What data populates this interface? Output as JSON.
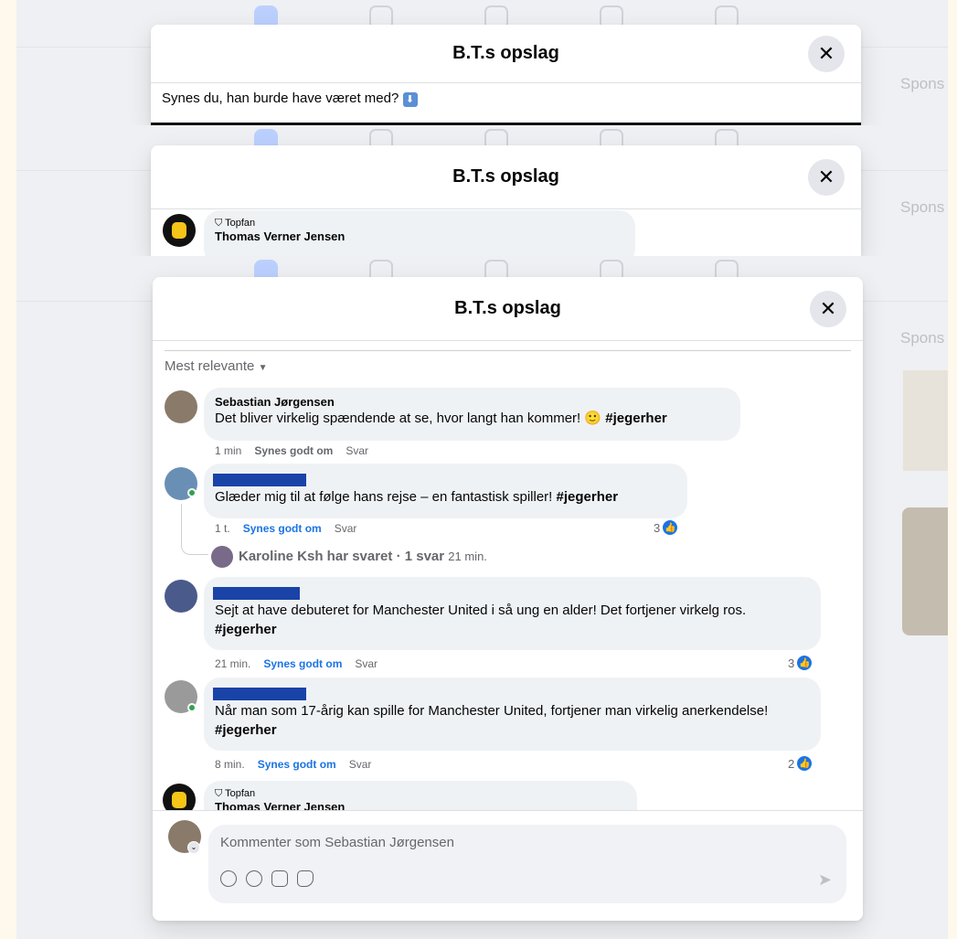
{
  "post_title": "B.T.s opslag",
  "close_glyph": "✕",
  "sponsored_label": "Spons",
  "panel1": {
    "caption": "Synes du, han burde have været med?",
    "caption_emoji": "⬇"
  },
  "panel2": {
    "badge": "Topfan",
    "name": "Thomas Verner Jensen"
  },
  "sort_label": "Mest relevante",
  "comments": [
    {
      "name": "Sebastian Jørgensen",
      "text": "Det bliver virkelig spændende at se, hvor langt han kommer!",
      "emoji": "🙂",
      "hashtag": "#jegerher",
      "time": "1 min",
      "like": "Synes godt om",
      "reply": "Svar",
      "count": ""
    },
    {
      "name": "",
      "text": "Glæder mig til at følge hans rejse – en fantastisk spiller!",
      "hashtag": "#jegerher",
      "time": "1 t.",
      "like": "Synes godt om",
      "reply": "Svar",
      "count": "3"
    },
    {
      "name": "",
      "text": "Sejt at have debuteret for Manchester United i så ung en alder! Det fortjener virkelg ros.",
      "hashtag": "#jegerher",
      "time": "21 min.",
      "like": "Synes godt om",
      "reply": "Svar",
      "count": "3"
    },
    {
      "name": "",
      "text": "Når man som 17-årig kan spille for Manchester United, fortjener man virkelig anerkendelse!",
      "hashtag": "#jegerher",
      "time": "8 min.",
      "like": "Synes godt om",
      "reply": "Svar",
      "count": "2"
    }
  ],
  "reply_thread": {
    "text": "Karoline Ksh har svaret · 1 svar",
    "time": "21 min."
  },
  "last_comment": {
    "badge": "Topfan",
    "name": "Thomas Verner Jensen"
  },
  "composer": {
    "placeholder": "Kommenter som Sebastian Jørgensen"
  },
  "composer_icons": [
    "avatar-sticker-icon",
    "emoji-icon",
    "gif-icon",
    "sticker-icon",
    "send-icon"
  ],
  "colors": {
    "accent": "#1b74e4",
    "redaction": "#1a43a8",
    "bubble": "#eff2f5"
  }
}
